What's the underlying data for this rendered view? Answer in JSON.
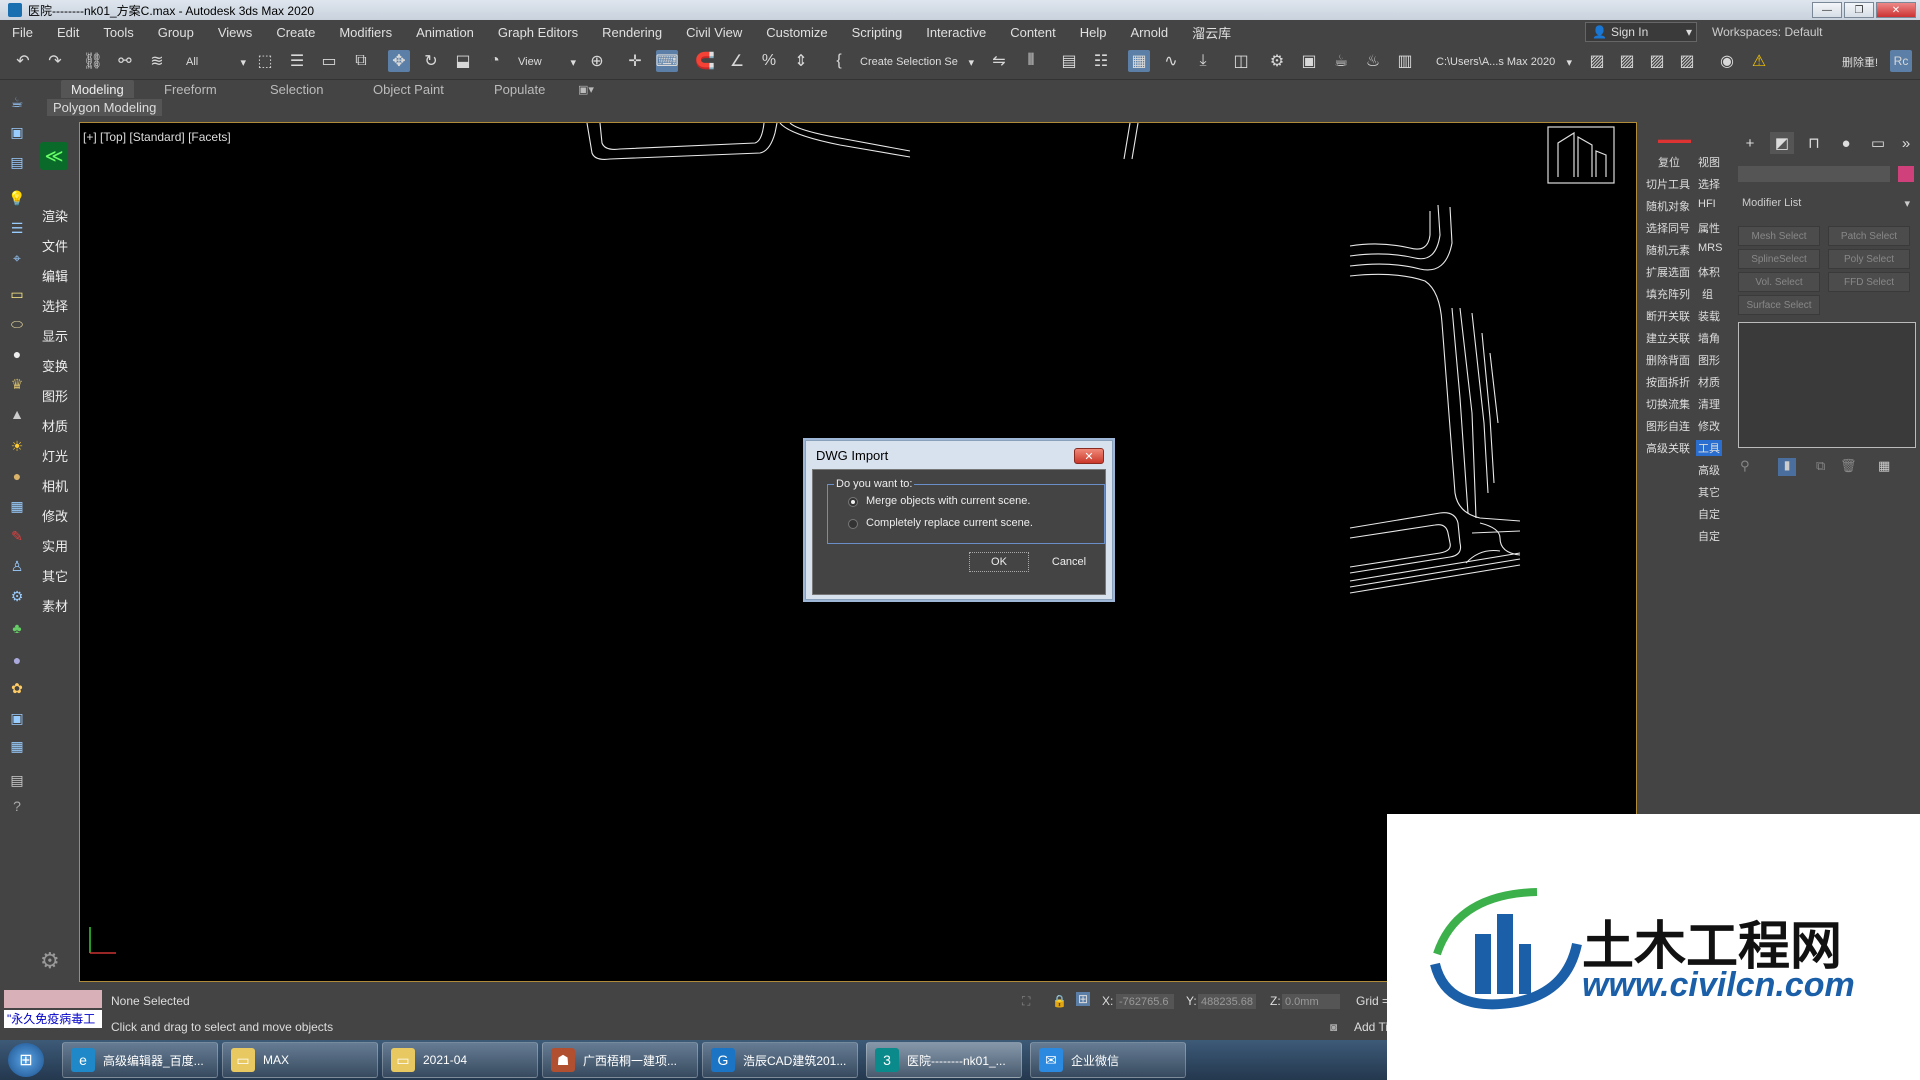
{
  "window": {
    "title": "医院--------nk01_方案C.max - Autodesk 3ds Max 2020"
  },
  "menus": [
    "File",
    "Edit",
    "Tools",
    "Group",
    "Views",
    "Create",
    "Modifiers",
    "Animation",
    "Graph Editors",
    "Rendering",
    "Civil View",
    "Customize",
    "Scripting",
    "Interactive",
    "Content",
    "Help",
    "Arnold",
    "溜云库"
  ],
  "signin": {
    "label": "Sign In"
  },
  "workspace": {
    "label": "Workspaces:",
    "value": "Default"
  },
  "toolbar": {
    "filter": "All",
    "ref_coord": "View",
    "selection_set": "Create Selection Se",
    "path": "C:\\Users\\A...s Max 2020",
    "right_label": "删除重!"
  },
  "ribbon": {
    "tabs": [
      "Modeling",
      "Freeform",
      "Selection",
      "Object Paint",
      "Populate"
    ],
    "active": "Modeling",
    "sub": "Polygon Modeling"
  },
  "left_panel": {
    "items": [
      "渲染",
      "文件",
      "编辑",
      "选择",
      "显示",
      "变换",
      "图形",
      "材质",
      "灯光",
      "相机",
      "修改",
      "实用",
      "其它",
      "素材"
    ]
  },
  "viewport": {
    "label": "[+] [Top] [Standard] [Facets]"
  },
  "right_tools": {
    "col1": [
      "复位",
      "切片工具",
      "随机对象",
      "选择同号",
      "随机元素",
      "扩展选面",
      "填充阵列",
      "断开关联",
      "建立关联",
      "删除背面",
      "按面拆折",
      "切换流集",
      "图形自连",
      "高级关联"
    ],
    "col2": [
      "视图",
      "选择",
      "HFI",
      "属性",
      "MRS",
      "体积",
      "组",
      "装载",
      "墙角",
      "图形",
      "材质",
      "清理",
      "修改",
      "工具",
      "高级",
      "其它",
      "自定",
      "自定"
    ]
  },
  "cmd_panel": {
    "modifier_list": "Modifier List",
    "buttons": [
      "Mesh Select",
      "Patch Select",
      "SplineSelect",
      "Poly Select",
      "Vol. Select",
      "FFD Select",
      "Surface Select"
    ]
  },
  "dialog": {
    "title": "DWG Import",
    "question": "Do you want to:",
    "options": [
      "Merge objects with current scene.",
      "Completely replace current scene."
    ],
    "selected": 0,
    "ok": "OK",
    "cancel": "Cancel"
  },
  "status": {
    "selection": "None Selected",
    "hint": "Click and drag to select and move objects",
    "maxscript": "\"永久免疫病毒工",
    "x_label": "X:",
    "x_value": "-762765.6",
    "y_label": "Y:",
    "y_value": "488235.68",
    "z_label": "Z:",
    "z_value": "0.0mm",
    "grid": "Grid =",
    "addtime": "Add Ti"
  },
  "taskbar": {
    "items": [
      "高级编辑器_百度...",
      "MAX",
      "2021-04",
      "广西梧桐一建项...",
      "浩辰CAD建筑201...",
      "医院--------nk01_...",
      "企业微信"
    ]
  },
  "watermark": {
    "brand": "土木工程网",
    "url": "www.civilcn.com"
  },
  "colors": {
    "accent": "#5b7fa6",
    "viewport_border": "#b08b3a",
    "watermark_blue": "#1a5fa8"
  }
}
